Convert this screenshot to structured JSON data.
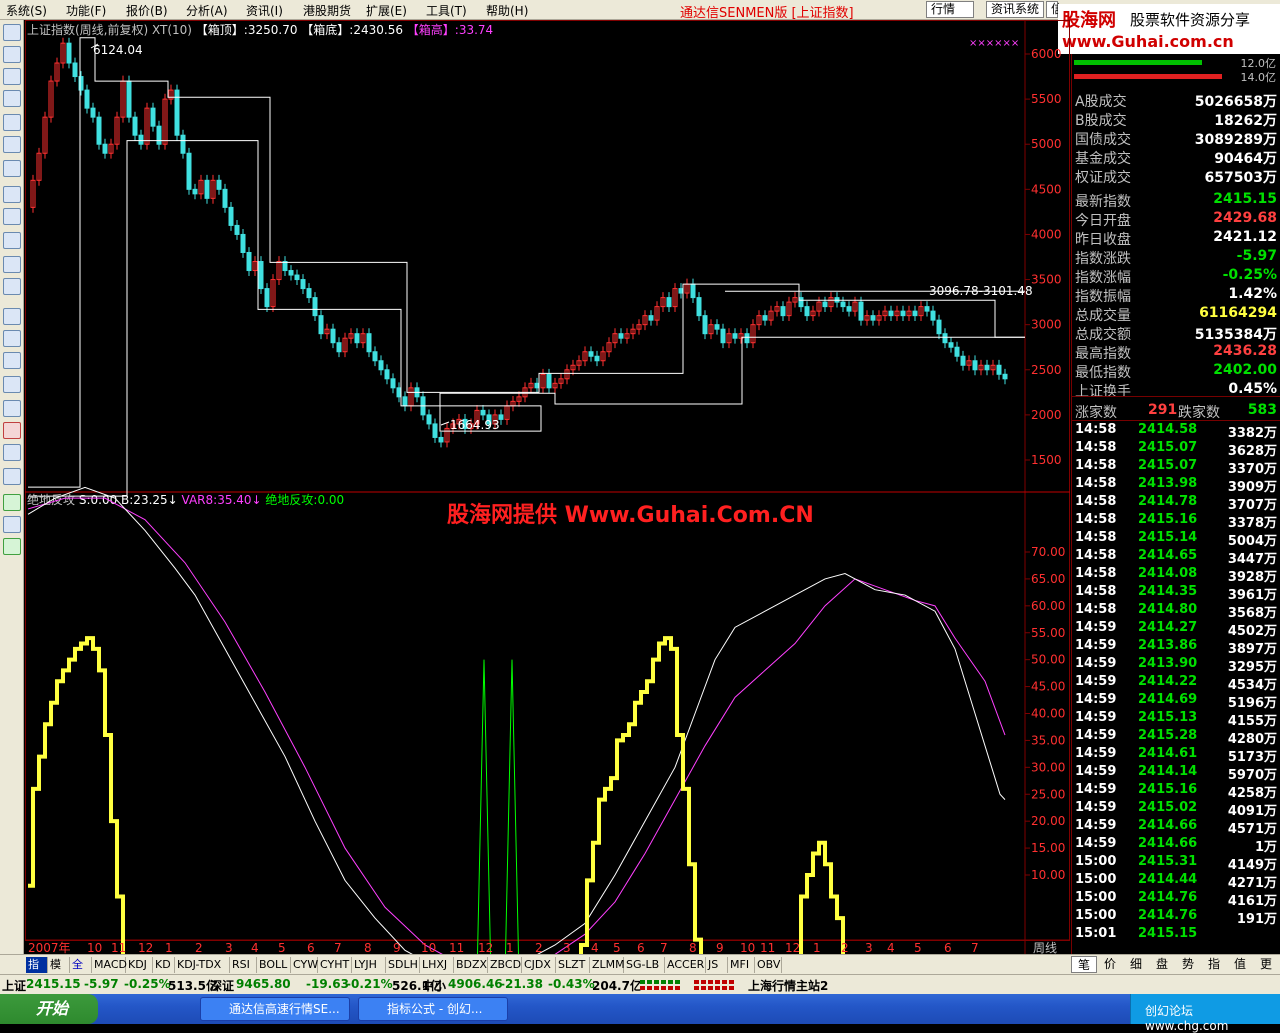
{
  "menu": [
    "系统(S)",
    "功能(F)",
    "报价(B)",
    "分析(A)",
    "资讯(I)",
    "港股期货",
    "扩展(E)",
    "工具(T)",
    "帮助(H)"
  ],
  "app_title": "通达信SENMEN版 [上证指数]",
  "toolbar_buttons": [
    "行情",
    "资讯系统",
    "信"
  ],
  "logo": {
    "site_cn": "股海网",
    "slogan": "股票软件资源分享",
    "url": "www.Guhai.com.cn"
  },
  "main_chart": {
    "header": {
      "name": "上证指数(周线,前复权)",
      "xt": "XT(10)",
      "box_top_label": "【箱顶】",
      "box_top": ":3250.70",
      "box_bottom_label": "【箱底】",
      "box_bottom": ":2430.56",
      "box_high_label": "【箱高】",
      "box_high": ":33.74"
    },
    "yticks": [
      6000,
      5500,
      5000,
      4500,
      4000,
      3500,
      3000,
      2500,
      2000,
      1500
    ],
    "high_label": "6124.04",
    "low_label": "1664.93",
    "recent_label": "3096.78-3101.48",
    "marker": "××××××"
  },
  "sub_chart": {
    "header": {
      "name": "绝地反攻",
      "s": "S:0.00",
      "b": "B:23.25",
      "var8": "VAR8:35.40",
      "jd": "绝地反攻:0.00"
    },
    "yticks": [
      "70.00",
      "65.00",
      "60.00",
      "55.00",
      "50.00",
      "45.00",
      "40.00",
      "35.00",
      "30.00",
      "25.00",
      "20.00",
      "15.00",
      "10.00"
    ],
    "watermark": "股海网提供 Www.Guhai.Com.CN"
  },
  "time_axis": {
    "labels": [
      "2007年",
      "10",
      "11",
      "12",
      "1",
      "2",
      "3",
      "4",
      "5",
      "6",
      "7",
      "8",
      "9",
      "10",
      "11",
      "12",
      "1",
      "2",
      "3",
      "4",
      "5",
      "6",
      "7",
      "8",
      "9",
      "10",
      "11",
      "12",
      "1",
      "2",
      "3",
      "4",
      "5",
      "6",
      "7"
    ],
    "period": "周线"
  },
  "colors": {
    "up": "#ff3030",
    "down": "#40e0e0",
    "white": "#ffffff",
    "purple": "#ff40ff",
    "yellow": "#ffff40",
    "green": "#00ff00",
    "grid": "#800000"
  },
  "right_panel": {
    "bars": [
      {
        "color": "#00c000",
        "label": "12.0亿"
      },
      {
        "color": "#e02020",
        "label": "14.0亿"
      }
    ],
    "rows": [
      {
        "k": "A股成交",
        "v": "5026658万",
        "c": "#ffffff"
      },
      {
        "k": "B股成交",
        "v": "18262万",
        "c": "#ffffff"
      },
      {
        "k": "国债成交",
        "v": "3089289万",
        "c": "#ffffff"
      },
      {
        "k": "基金成交",
        "v": "90464万",
        "c": "#ffffff"
      },
      {
        "k": "权证成交",
        "v": "657503万",
        "c": "#ffffff"
      },
      {
        "k": "最新指数",
        "v": "2415.15",
        "c": "#00e000"
      },
      {
        "k": "今日开盘",
        "v": "2429.68",
        "c": "#ff4040"
      },
      {
        "k": "昨日收盘",
        "v": "2421.12",
        "c": "#ffffff"
      },
      {
        "k": "指数涨跌",
        "v": "-5.97",
        "c": "#00e000"
      },
      {
        "k": "指数涨幅",
        "v": "-0.25%",
        "c": "#00e000"
      },
      {
        "k": "指数振幅",
        "v": "1.42%",
        "c": "#ffffff"
      },
      {
        "k": "总成交量",
        "v": "61164294",
        "c": "#ffff40"
      },
      {
        "k": "总成交额",
        "v": "5135384万",
        "c": "#ffffff"
      },
      {
        "k": "最高指数",
        "v": "2436.28",
        "c": "#ff4040"
      },
      {
        "k": "最低指数",
        "v": "2402.00",
        "c": "#00e000"
      },
      {
        "k": "上证换手",
        "v": "0.45%",
        "c": "#ffffff"
      }
    ],
    "updown": {
      "up_label": "涨家数",
      "up": "291",
      "down_label": "跌家数",
      "down": "583"
    },
    "ticks": [
      [
        "14:58",
        "2414.58",
        "3382万"
      ],
      [
        "14:58",
        "2415.07",
        "3628万"
      ],
      [
        "14:58",
        "2415.07",
        "3370万"
      ],
      [
        "14:58",
        "2413.98",
        "3909万"
      ],
      [
        "14:58",
        "2414.78",
        "3707万"
      ],
      [
        "14:58",
        "2415.16",
        "3378万"
      ],
      [
        "14:58",
        "2415.14",
        "5004万"
      ],
      [
        "14:58",
        "2414.65",
        "3447万"
      ],
      [
        "14:58",
        "2414.08",
        "3928万"
      ],
      [
        "14:58",
        "2414.35",
        "3961万"
      ],
      [
        "14:58",
        "2414.80",
        "3568万"
      ],
      [
        "14:59",
        "2414.27",
        "4502万"
      ],
      [
        "14:59",
        "2413.86",
        "3897万"
      ],
      [
        "14:59",
        "2413.90",
        "3295万"
      ],
      [
        "14:59",
        "2414.22",
        "4534万"
      ],
      [
        "14:59",
        "2414.69",
        "5196万"
      ],
      [
        "14:59",
        "2415.13",
        "4155万"
      ],
      [
        "14:59",
        "2415.28",
        "4280万"
      ],
      [
        "14:59",
        "2414.61",
        "5173万"
      ],
      [
        "14:59",
        "2414.14",
        "5970万"
      ],
      [
        "14:59",
        "2415.16",
        "4258万"
      ],
      [
        "14:59",
        "2415.02",
        "4091万"
      ],
      [
        "14:59",
        "2414.66",
        "4571万"
      ],
      [
        "14:59",
        "2414.66",
        "1万"
      ],
      [
        "15:00",
        "2415.31",
        "4149万"
      ],
      [
        "15:00",
        "2414.44",
        "4271万"
      ],
      [
        "15:00",
        "2414.76",
        "4161万"
      ],
      [
        "15:00",
        "2414.76",
        "191万"
      ],
      [
        "15:01",
        "2415.15",
        ""
      ]
    ]
  },
  "bottom_tabs": [
    "指标",
    "模板",
    "全部",
    "MACD",
    "KDJ",
    "KD",
    "KDJ-TDX",
    "RSI",
    "BOLL",
    "CYW",
    "CYHT",
    "LYJH",
    "SDLH",
    "LHXJ",
    "BDZX",
    "ZBCD",
    "CJDX",
    "SLZT",
    "ZLMM",
    "SG-LB",
    "ACCER",
    "JS",
    "MFI",
    "OBV"
  ],
  "right_tabs": [
    "笔",
    "价",
    "细",
    "盘",
    "势",
    "指",
    "值",
    "更"
  ],
  "status": {
    "sh_label": "上证",
    "sh_val": "2415.15",
    "sh_chg": "-5.97",
    "sh_pct": "-0.25%",
    "sh_amt": "513.5亿",
    "sz_label": "深证",
    "sz_val": "9465.80",
    "sz_chg": "-19.63",
    "sz_pct": "-0.21%",
    "sz_amt": "526.1亿",
    "zx_label": "中小",
    "zx_val": "4906.46",
    "zx_chg": "-21.38",
    "zx_pct": "-0.43%",
    "zx_amt": "204.7亿",
    "server": "上海行情主站2"
  },
  "taskbar": {
    "start": "开始",
    "tasks": [
      "通达信高速行情SE...",
      "指标公式 - 创幻..."
    ],
    "tray": "创幻论坛 www.chg.com"
  }
}
